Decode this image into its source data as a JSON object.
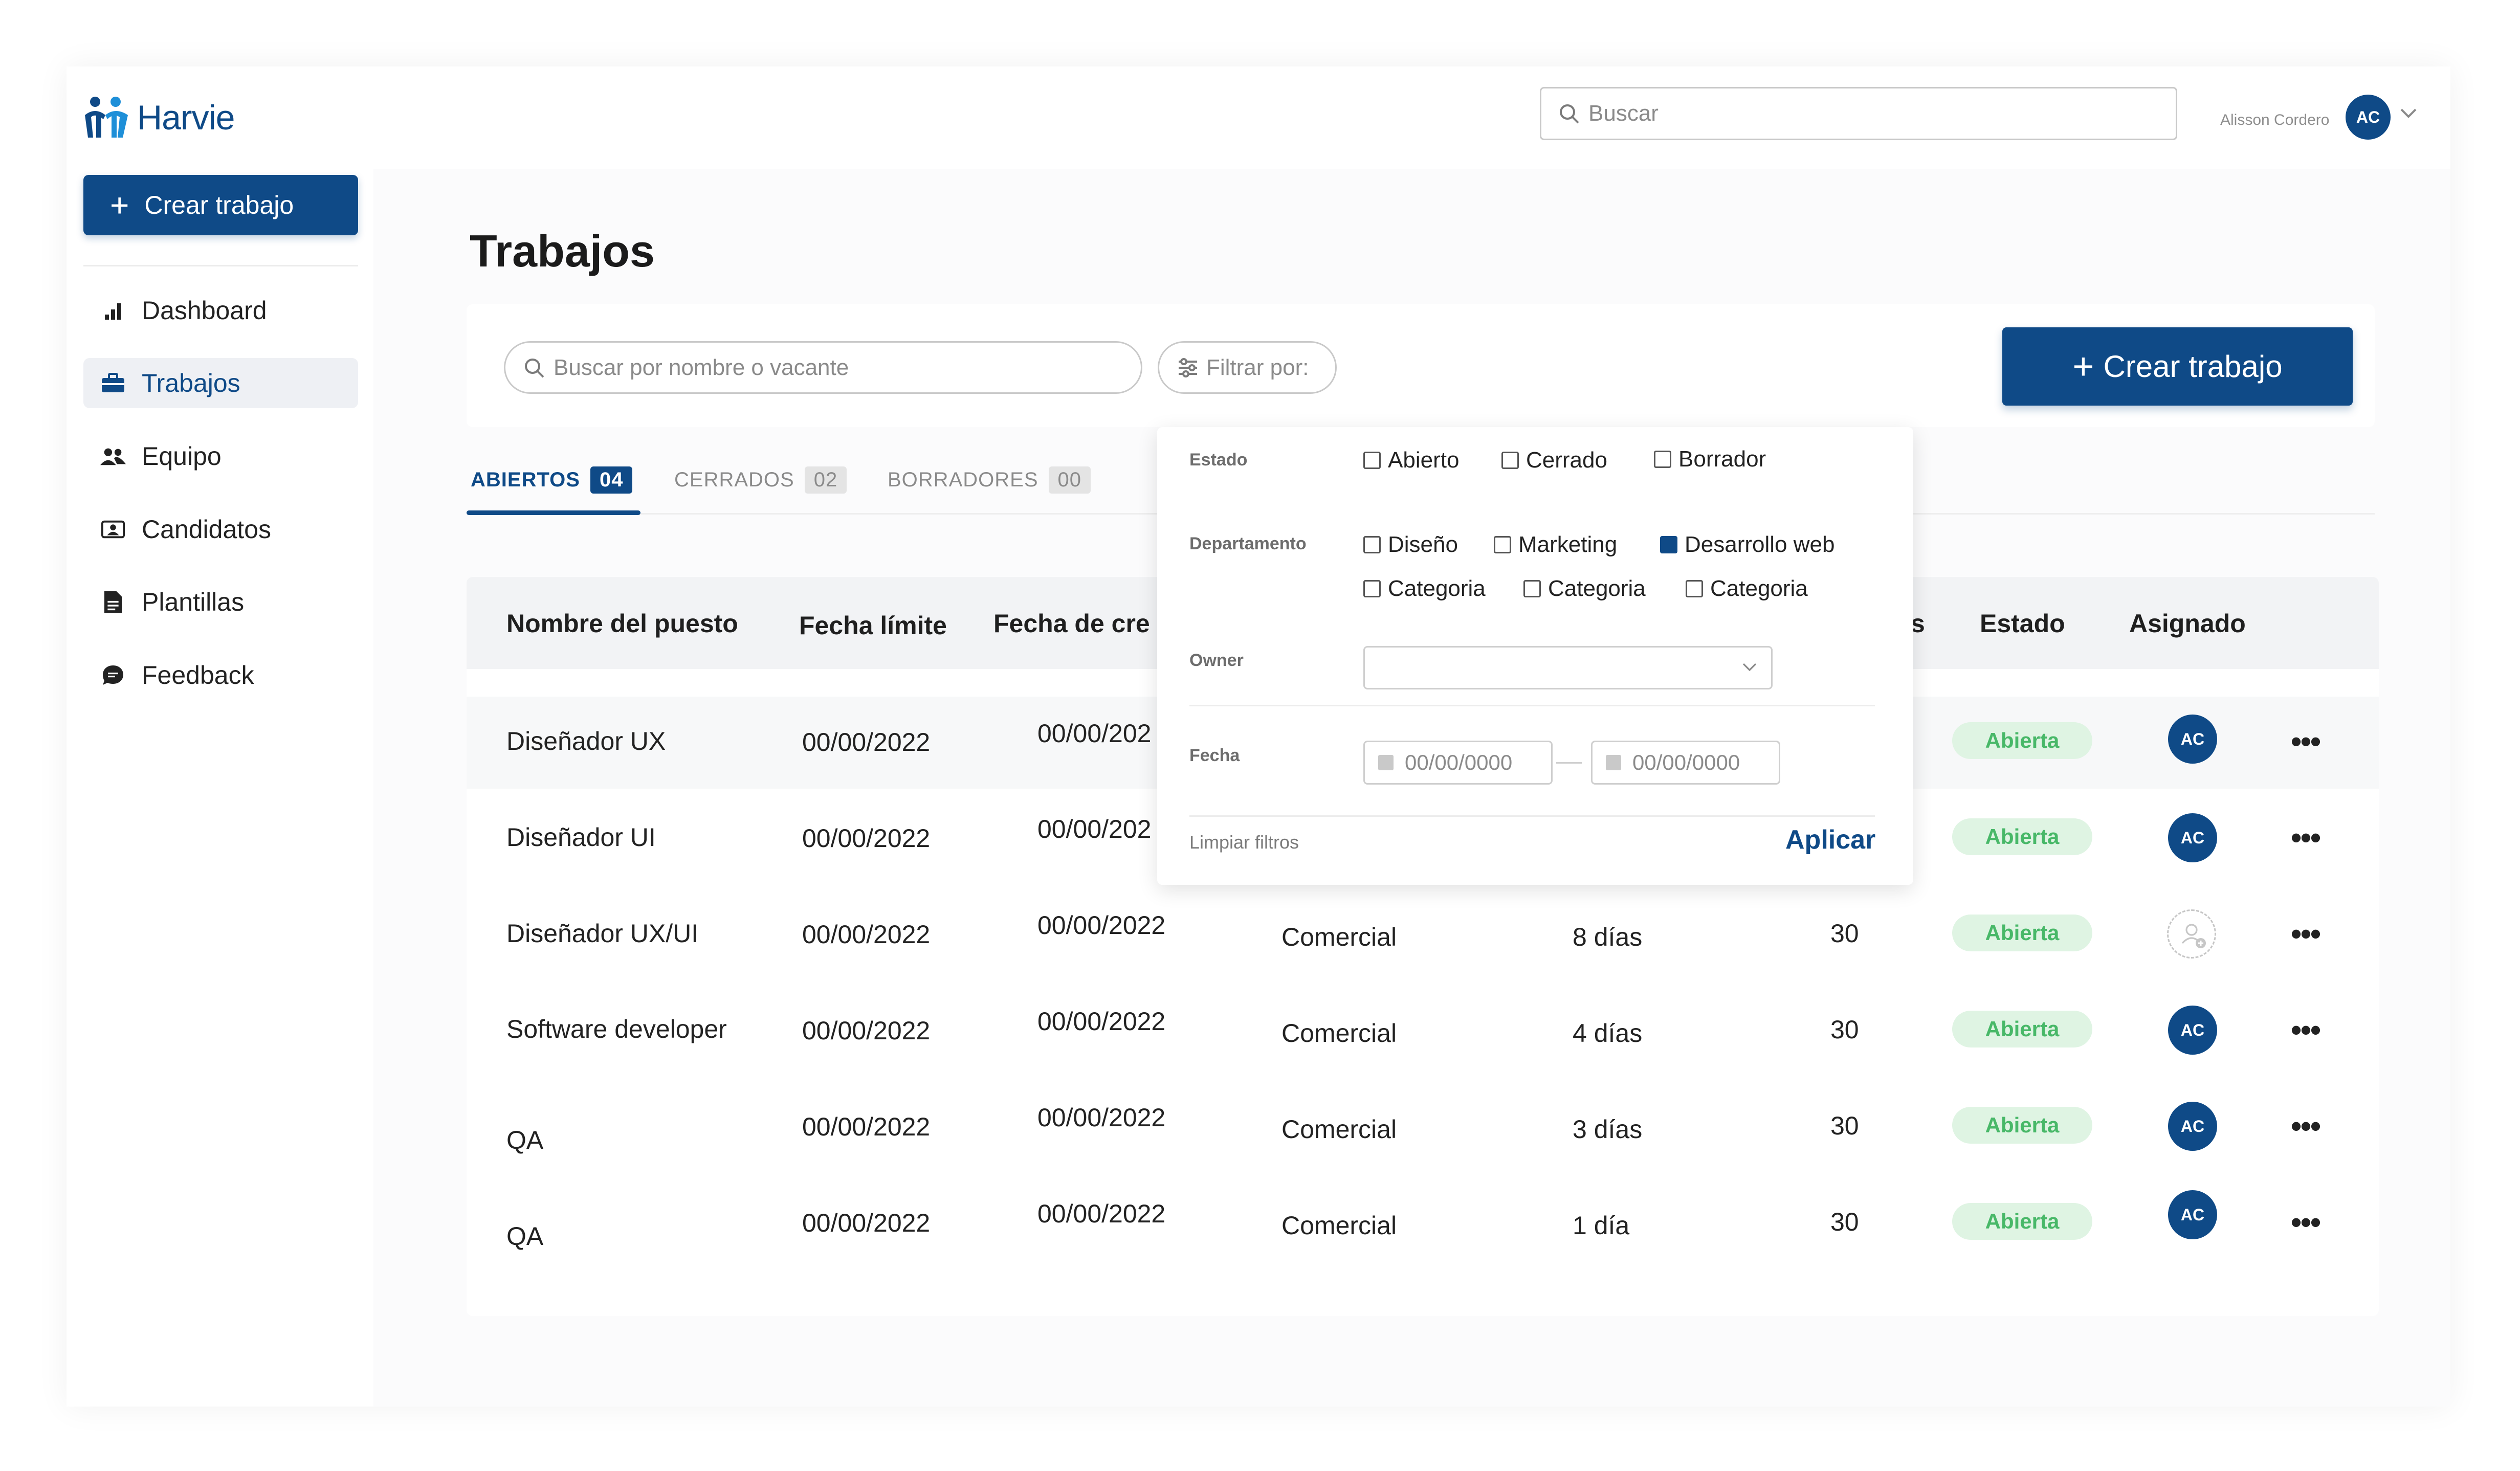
{
  "brand": {
    "name": "Harvie",
    "accent": "#0f4a87",
    "success_bg": "#dff4e3",
    "success_text": "#48b868"
  },
  "sidebar": {
    "create_label": "Crear trabajo",
    "items": [
      {
        "label": "Dashboard",
        "icon": "bar-chart-icon"
      },
      {
        "label": "Trabajos",
        "icon": "briefcase-icon",
        "active": true
      },
      {
        "label": "Equipo",
        "icon": "team-icon"
      },
      {
        "label": "Candidatos",
        "icon": "id-card-icon"
      },
      {
        "label": "Plantillas",
        "icon": "document-icon"
      },
      {
        "label": "Feedback",
        "icon": "chat-bubble-icon"
      }
    ]
  },
  "topbar": {
    "search_placeholder": "Buscar",
    "user_name": "Alisson Cordero",
    "user_initials": "AC"
  },
  "main": {
    "title": "Trabajos",
    "search_placeholder": "Buscar por nombre o vacante",
    "filter_label": "Filtrar por:",
    "create_label": "Crear trabajo",
    "tabs": [
      {
        "label": "ABIERTOS",
        "count": "04",
        "active": true
      },
      {
        "label": "CERRADOS",
        "count": "02"
      },
      {
        "label": "BORRADORES",
        "count": "00"
      }
    ]
  },
  "table": {
    "headers": [
      "Nombre del puesto",
      "Fecha límite",
      "Fecha de cre",
      "s",
      "Estado",
      "Asignado"
    ],
    "rows": [
      {
        "name": "Diseñador UX",
        "deadline": "00/00/2022",
        "created": "00/00/202",
        "status": "Abierta",
        "assignee": "AC"
      },
      {
        "name": "Diseñador UI",
        "deadline": "00/00/2022",
        "created": "00/00/202",
        "status": "Abierta",
        "assignee": "AC"
      },
      {
        "name": "Diseñador UX/UI",
        "deadline": "00/00/2022",
        "created": "00/00/2022",
        "department": "Comercial",
        "days": "8 días",
        "count": "30",
        "status": "Abierta",
        "assignee": ""
      },
      {
        "name": "Software developer",
        "deadline": "00/00/2022",
        "created": "00/00/2022",
        "department": "Comercial",
        "days": "4 días",
        "count": "30",
        "status": "Abierta",
        "assignee": "AC"
      },
      {
        "name": "QA",
        "deadline": "00/00/2022",
        "created": "00/00/2022",
        "department": "Comercial",
        "days": "3 días",
        "count": "30",
        "status": "Abierta",
        "assignee": "AC"
      },
      {
        "name": "QA",
        "deadline": "00/00/2022",
        "created": "00/00/2022",
        "department": "Comercial",
        "days": "1 día",
        "count": "30",
        "status": "Abierta",
        "assignee": "AC"
      }
    ]
  },
  "filter_panel": {
    "estado_label": "Estado",
    "estado_options": [
      {
        "label": "Abierto",
        "checked": false
      },
      {
        "label": "Cerrado",
        "checked": false
      },
      {
        "label": "Borrador",
        "checked": false
      }
    ],
    "departamento_label": "Departamento",
    "departamento_options": [
      {
        "label": "Diseño",
        "checked": false
      },
      {
        "label": "Marketing",
        "checked": false
      },
      {
        "label": "Desarrollo web",
        "checked": true
      },
      {
        "label": "Categoria",
        "checked": false
      },
      {
        "label": "Categoria",
        "checked": false
      },
      {
        "label": "Categoria",
        "checked": false
      }
    ],
    "owner_label": "Owner",
    "owner_value": "",
    "fecha_label": "Fecha",
    "date_from_placeholder": "00/00/0000",
    "date_to_placeholder": "00/00/0000",
    "clear_label": "Limpiar filtros",
    "apply_label": "Aplicar"
  }
}
